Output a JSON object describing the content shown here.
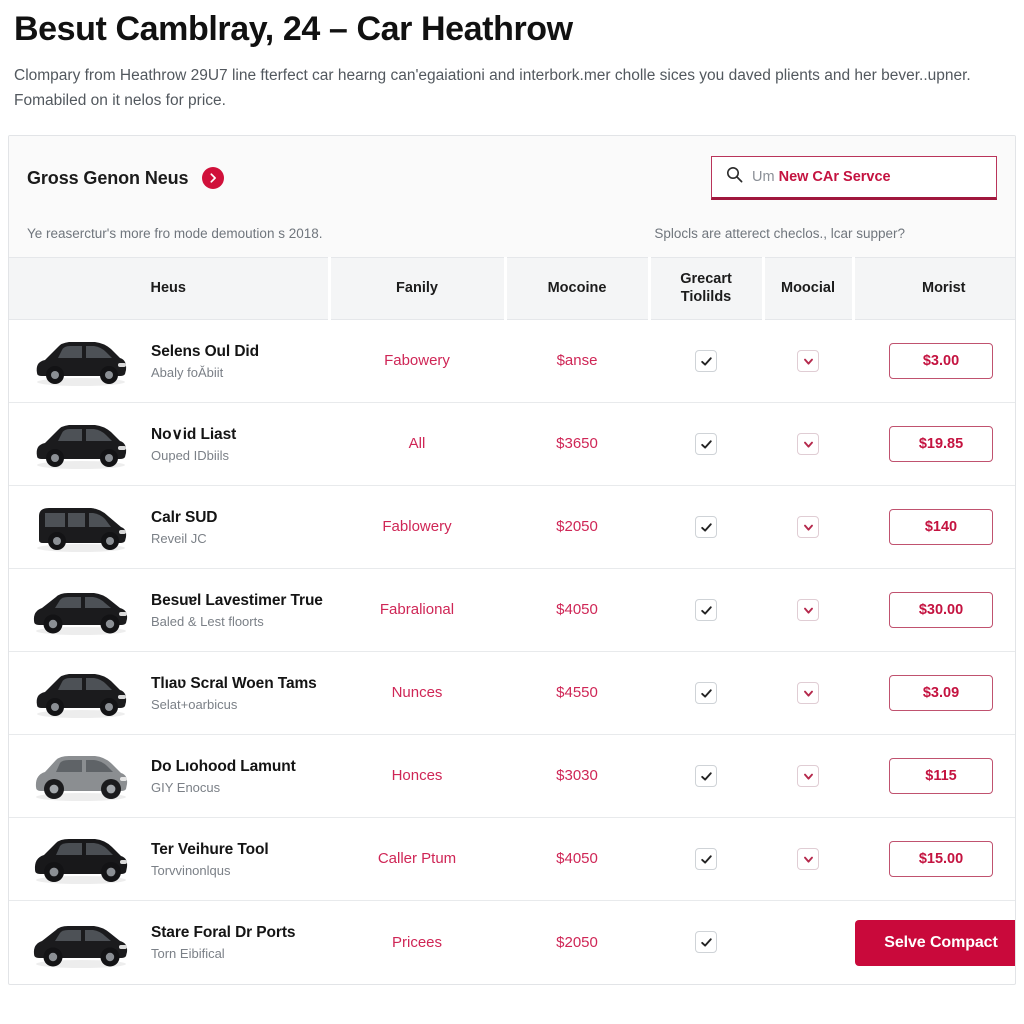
{
  "header": {
    "title": "Besut Camblray, 24 – Car Heathrow",
    "intro": "Clompary from Heathrow 29U7 line fterfect car hearng can'egaiationi and interbork.mer cholle sices you daved plients and her bever..upner. Fomabiled on it nelos for price."
  },
  "card": {
    "heading": "Gross Genon Neus",
    "heading_icon": "chevron-right-icon",
    "sub_left": "Ye reaserctur's more fro mode demoution s 2018.",
    "sub_right": "Splocls are atterect checlos., lcar supper?",
    "search": {
      "icon": "search-icon",
      "placeholder": "Um",
      "value": "New CAr Servce"
    }
  },
  "table": {
    "columns": [
      "Heus",
      "Fanily",
      "Mocoine",
      "Grecart Tiolilds",
      "Moocial",
      "Morist"
    ],
    "rows": [
      {
        "title": "Selens Oul Did",
        "subtitle": "Abaly foǍbiit",
        "family": "Fabowery",
        "engine": "$anse",
        "grade_checked": true,
        "model_checked": true,
        "price": "$3.00",
        "thumb": "car-hatchback-black",
        "action_type": "price"
      },
      {
        "title": "No∨id Liast",
        "subtitle": "Ouped IDbiils",
        "family": "All",
        "engine": "$3650",
        "grade_checked": true,
        "model_checked": true,
        "price": "$19.85",
        "thumb": "car-hatchback-black",
        "action_type": "price"
      },
      {
        "title": "Calr SUD",
        "subtitle": "Reveil JC",
        "family": "Fablowery",
        "engine": "$2050",
        "grade_checked": true,
        "model_checked": true,
        "price": "$140",
        "thumb": "car-van-black",
        "action_type": "price"
      },
      {
        "title": "Besuɐl Lavestimer True",
        "subtitle": "Baled & Lest floorts",
        "family": "Fabralional",
        "engine": "$4050",
        "grade_checked": true,
        "model_checked": true,
        "price": "$30.00",
        "thumb": "car-sedan-black",
        "action_type": "price"
      },
      {
        "title": "Tlıaʋ Scral Woen Tams",
        "subtitle": "Selat+oarbicus",
        "family": "Nunces",
        "engine": "$4550",
        "grade_checked": true,
        "model_checked": true,
        "price": "$3.09",
        "thumb": "car-hatchback-black",
        "action_type": "price"
      },
      {
        "title": "Do Lıohood Lamunt",
        "subtitle": "GIY Enocus",
        "family": "Honces",
        "engine": "$3030",
        "grade_checked": true,
        "model_checked": true,
        "price": "$115",
        "thumb": "car-mpv-grey",
        "action_type": "price"
      },
      {
        "title": "Ter Veihure Tool",
        "subtitle": "Torvvinonlqus",
        "family": "Caller Ptum",
        "engine": "$4050",
        "grade_checked": true,
        "model_checked": true,
        "price": "$15.00",
        "thumb": "car-suv-black",
        "action_type": "price"
      },
      {
        "title": "Stare Foral Dr Ports",
        "subtitle": "Torn Eibifical",
        "family": "Pricees",
        "engine": "$2050",
        "grade_checked": true,
        "model_checked": false,
        "price": "Selve Compact",
        "thumb": "car-sedan-black",
        "action_type": "cta"
      }
    ]
  },
  "colors": {
    "accent": "#c9093b",
    "accent_text": "#c41340",
    "family_text": "#cf2656",
    "border": "#e2e4e7",
    "header_bg": "#f4f5f6"
  }
}
